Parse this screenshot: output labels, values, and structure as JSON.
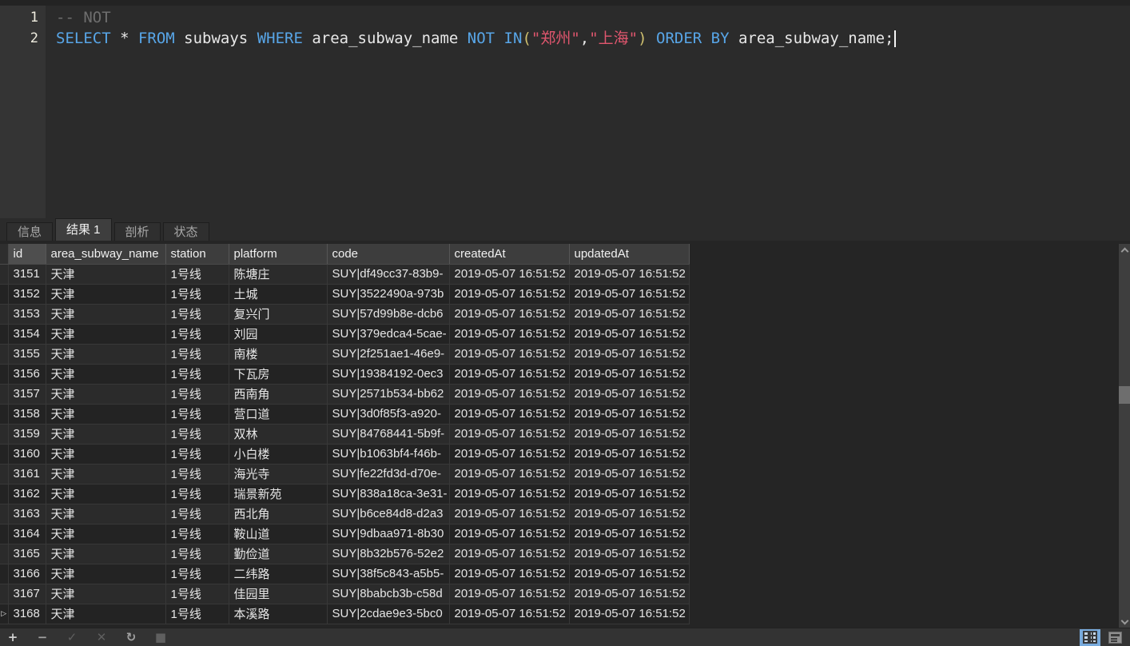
{
  "editor": {
    "lines": [
      {
        "number": "1",
        "tokens": [
          {
            "text": "-- NOT",
            "type": "comment"
          }
        ],
        "cursor": false
      },
      {
        "number": "2",
        "tokens": [
          {
            "text": "SELECT",
            "type": "keyword"
          },
          {
            "text": " * ",
            "type": "plain"
          },
          {
            "text": "FROM",
            "type": "keyword"
          },
          {
            "text": " subways ",
            "type": "plain"
          },
          {
            "text": "WHERE",
            "type": "keyword"
          },
          {
            "text": " area_subway_name ",
            "type": "plain"
          },
          {
            "text": "NOT IN",
            "type": "keyword"
          },
          {
            "text": "(",
            "type": "paren"
          },
          {
            "text": "\"郑州\"",
            "type": "string"
          },
          {
            "text": ",",
            "type": "plain"
          },
          {
            "text": "\"上海\"",
            "type": "string"
          },
          {
            "text": ")",
            "type": "paren"
          },
          {
            "text": " ",
            "type": "plain"
          },
          {
            "text": "ORDER BY",
            "type": "keyword"
          },
          {
            "text": " area_subway_name;",
            "type": "plain"
          }
        ],
        "cursor": true
      }
    ]
  },
  "tabs": {
    "items": [
      {
        "name": "tab-info",
        "label": "信息",
        "active": false
      },
      {
        "name": "tab-result-1",
        "label": "结果 1",
        "active": true
      },
      {
        "name": "tab-profile",
        "label": "剖析",
        "active": false
      },
      {
        "name": "tab-status",
        "label": "状态",
        "active": false
      }
    ]
  },
  "grid": {
    "columns": [
      "id",
      "area_subway_name",
      "station",
      "platform",
      "code",
      "createdAt",
      "updatedAt"
    ],
    "highlighted_column": "id",
    "row_marker_glyph": "▷",
    "marker_row_index": 17,
    "rows": [
      [
        "3151",
        "天津",
        "1号线",
        "陈塘庄",
        "SUY|df49cc37-83b9-",
        "2019-05-07 16:51:52",
        "2019-05-07 16:51:52"
      ],
      [
        "3152",
        "天津",
        "1号线",
        "土城",
        "SUY|3522490a-973b",
        "2019-05-07 16:51:52",
        "2019-05-07 16:51:52"
      ],
      [
        "3153",
        "天津",
        "1号线",
        "复兴门",
        "SUY|57d99b8e-dcb6",
        "2019-05-07 16:51:52",
        "2019-05-07 16:51:52"
      ],
      [
        "3154",
        "天津",
        "1号线",
        "刘园",
        "SUY|379edca4-5cae-",
        "2019-05-07 16:51:52",
        "2019-05-07 16:51:52"
      ],
      [
        "3155",
        "天津",
        "1号线",
        "南楼",
        "SUY|2f251ae1-46e9-",
        "2019-05-07 16:51:52",
        "2019-05-07 16:51:52"
      ],
      [
        "3156",
        "天津",
        "1号线",
        "下瓦房",
        "SUY|19384192-0ec3",
        "2019-05-07 16:51:52",
        "2019-05-07 16:51:52"
      ],
      [
        "3157",
        "天津",
        "1号线",
        "西南角",
        "SUY|2571b534-bb62",
        "2019-05-07 16:51:52",
        "2019-05-07 16:51:52"
      ],
      [
        "3158",
        "天津",
        "1号线",
        "营口道",
        "SUY|3d0f85f3-a920-",
        "2019-05-07 16:51:52",
        "2019-05-07 16:51:52"
      ],
      [
        "3159",
        "天津",
        "1号线",
        "双林",
        "SUY|84768441-5b9f-",
        "2019-05-07 16:51:52",
        "2019-05-07 16:51:52"
      ],
      [
        "3160",
        "天津",
        "1号线",
        "小白楼",
        "SUY|b1063bf4-f46b-",
        "2019-05-07 16:51:52",
        "2019-05-07 16:51:52"
      ],
      [
        "3161",
        "天津",
        "1号线",
        "海光寺",
        "SUY|fe22fd3d-d70e-",
        "2019-05-07 16:51:52",
        "2019-05-07 16:51:52"
      ],
      [
        "3162",
        "天津",
        "1号线",
        "瑞景新苑",
        "SUY|838a18ca-3e31-",
        "2019-05-07 16:51:52",
        "2019-05-07 16:51:52"
      ],
      [
        "3163",
        "天津",
        "1号线",
        "西北角",
        "SUY|b6ce84d8-d2a3",
        "2019-05-07 16:51:52",
        "2019-05-07 16:51:52"
      ],
      [
        "3164",
        "天津",
        "1号线",
        "鞍山道",
        "SUY|9dbaa971-8b30",
        "2019-05-07 16:51:52",
        "2019-05-07 16:51:52"
      ],
      [
        "3165",
        "天津",
        "1号线",
        "勤俭道",
        "SUY|8b32b576-52e2",
        "2019-05-07 16:51:52",
        "2019-05-07 16:51:52"
      ],
      [
        "3166",
        "天津",
        "1号线",
        "二纬路",
        "SUY|38f5c843-a5b5-",
        "2019-05-07 16:51:52",
        "2019-05-07 16:51:52"
      ],
      [
        "3167",
        "天津",
        "1号线",
        "佳园里",
        "SUY|8babcb3b-c58d",
        "2019-05-07 16:51:52",
        "2019-05-07 16:51:52"
      ],
      [
        "3168",
        "天津",
        "1号线",
        "本溪路",
        "SUY|2cdae9e3-5bc0",
        "2019-05-07 16:51:52",
        "2019-05-07 16:51:52"
      ]
    ]
  },
  "toolbar": {
    "buttons": [
      {
        "name": "add-row-button",
        "glyph": "+",
        "tone": "bright"
      },
      {
        "name": "delete-row-button",
        "glyph": "−",
        "tone": "mid"
      },
      {
        "name": "apply-changes-button",
        "glyph": "✓",
        "tone": "dim"
      },
      {
        "name": "discard-changes-button",
        "glyph": "✕",
        "tone": "dim"
      },
      {
        "name": "refresh-button",
        "glyph": "↻",
        "tone": "mid"
      },
      {
        "name": "stop-button",
        "glyph": "■",
        "tone": "dim"
      }
    ]
  },
  "colors": {
    "keyword": "#58a6e8",
    "string": "#e0566e",
    "comment": "#6e6e6e",
    "plain": "#e8e8e8",
    "paren": "#cfc06f",
    "view_toggle_active": "#78aadc",
    "editor_bg": "#2b2b2b",
    "grid_bg": "#252525"
  }
}
